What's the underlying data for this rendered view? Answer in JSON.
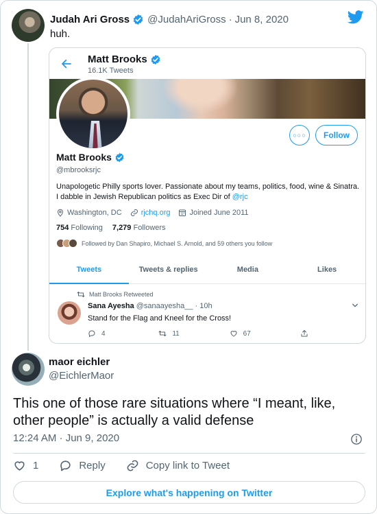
{
  "parent_tweet": {
    "author_name": "Judah Ari Gross",
    "handle": "@JudahAriGross",
    "separator": "·",
    "date": "Jun 8, 2020",
    "text": "huh."
  },
  "screenshot": {
    "profile_name": "Matt Brooks",
    "tweet_count": "16.1K Tweets",
    "more_button": "○○○",
    "follow_label": "Follow",
    "handle": "@mbrooksrjc",
    "bio_text": "Unapologetic Philly sports lover. Passionate about my teams, politics, food, wine & Sinatra. I dabble in Jewish Republican politics as Exec Dir of ",
    "bio_link": "@rjc",
    "location": "Washington, DC",
    "website": "rjchq.org",
    "joined": "Joined June 2011",
    "following_count": "754",
    "following_label": "Following",
    "followers_count": "7,279",
    "followers_label": "Followers",
    "followed_by": "Followed by Dan Shapiro, Michael S. Arnold, and 59 others you follow",
    "tabs": [
      "Tweets",
      "Tweets & replies",
      "Media",
      "Likes"
    ],
    "retweet_context": "Matt Brooks Retweeted",
    "rt_author_name": "Sana Ayesha",
    "rt_author_meta": "@sanaayesha__ · 10h",
    "rt_text": "Stand for the Flag and Kneel for the Cross!",
    "rt_replies": "4",
    "rt_retweets": "11",
    "rt_likes": "67"
  },
  "quote_tweet": {
    "author_name": "maor eichler",
    "handle": "@EichlerMaor",
    "text": "This one of those rare situations where “I meant, like, other people” is actually a valid defense",
    "timestamp": "12:24 AM · Jun 9, 2020",
    "like_count": "1",
    "reply_label": "Reply",
    "copy_link_label": "Copy link to Tweet"
  },
  "explore_label": "Explore what's happening on Twitter",
  "colors": {
    "accent": "#1d9bf0",
    "text": "#0f1419",
    "muted": "#536471",
    "border": "#cfd9de"
  }
}
